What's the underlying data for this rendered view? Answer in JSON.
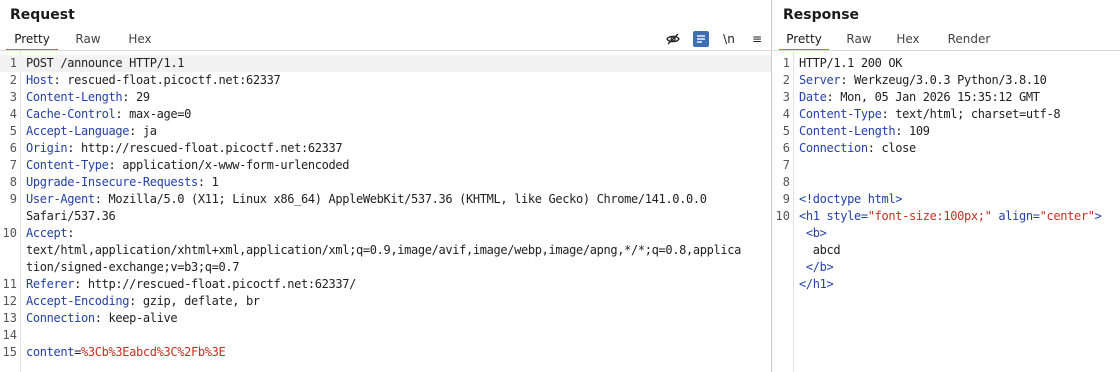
{
  "request": {
    "title": "Request",
    "tabs": [
      "Pretty",
      "Raw",
      "Hex"
    ],
    "active_tab": 0,
    "toolbar": {
      "icons": [
        "eye-slash-icon",
        "wrap-lines-icon",
        "newline-toggle",
        "menu-icon"
      ],
      "newline_label": "\\n",
      "menu_label": "≡"
    },
    "lines": [
      {
        "n": "1",
        "text": "POST /announce HTTP/1.1"
      },
      {
        "n": "2",
        "name": "Host",
        "value": "rescued-float.picoctf.net:62337"
      },
      {
        "n": "3",
        "name": "Content-Length",
        "value": "29"
      },
      {
        "n": "4",
        "name": "Cache-Control",
        "value": "max-age=0"
      },
      {
        "n": "5",
        "name": "Accept-Language",
        "value": "ja"
      },
      {
        "n": "6",
        "name": "Origin",
        "value": "http://rescued-float.picoctf.net:62337"
      },
      {
        "n": "7",
        "name": "Content-Type",
        "value": "application/x-www-form-urlencoded"
      },
      {
        "n": "8",
        "name": "Upgrade-Insecure-Requests",
        "value": "1"
      },
      {
        "n": "9",
        "name": "User-Agent",
        "value": "Mozilla/5.0 (X11; Linux x86_64) AppleWebKit/537.36 (KHTML, like Gecko) Chrome/141.0.0.0"
      },
      {
        "n": "",
        "text": "Safari/537.36"
      },
      {
        "n": "10",
        "name": "Accept",
        "value": ""
      },
      {
        "n": "",
        "text": "text/html,application/xhtml+xml,application/xml;q=0.9,image/avif,image/webp,image/apng,*/*;q=0.8,applica"
      },
      {
        "n": "",
        "text": "tion/signed-exchange;v=b3;q=0.7"
      },
      {
        "n": "11",
        "name": "Referer",
        "value": "http://rescued-float.picoctf.net:62337/"
      },
      {
        "n": "12",
        "name": "Accept-Encoding",
        "value": "gzip, deflate, br"
      },
      {
        "n": "13",
        "name": "Connection",
        "value": "keep-alive"
      },
      {
        "n": "14",
        "text": ""
      },
      {
        "n": "15",
        "param": "content",
        "param_value": "%3Cb%3Eabcd%3C%2Fb%3E"
      }
    ]
  },
  "response": {
    "title": "Response",
    "tabs": [
      "Pretty",
      "Raw",
      "Hex",
      "Render"
    ],
    "active_tab": 0,
    "lines": [
      {
        "n": "1",
        "text": "HTTP/1.1 200 OK"
      },
      {
        "n": "2",
        "name": "Server",
        "value": "Werkzeug/3.0.3 Python/3.8.10"
      },
      {
        "n": "3",
        "name": "Date",
        "value": "Mon, 05 Jan 2026 15:35:12 GMT"
      },
      {
        "n": "4",
        "name": "Content-Type",
        "value": "text/html; charset=utf-8"
      },
      {
        "n": "5",
        "name": "Content-Length",
        "value": "109"
      },
      {
        "n": "6",
        "name": "Connection",
        "value": "close"
      },
      {
        "n": "7",
        "text": ""
      },
      {
        "n": "8",
        "text": ""
      },
      {
        "n": "9",
        "html": [
          {
            "c": "tag",
            "t": "<!doctype html>"
          }
        ]
      },
      {
        "n": "10",
        "html": [
          {
            "c": "tag",
            "t": "<h1 "
          },
          {
            "c": "attr",
            "t": "style="
          },
          {
            "c": "aval",
            "t": "\"font-size:100px;\""
          },
          {
            "c": "attr",
            "t": " align="
          },
          {
            "c": "aval",
            "t": "\"center\""
          },
          {
            "c": "tag",
            "t": ">"
          }
        ]
      },
      {
        "n": "",
        "html": [
          {
            "c": "plain",
            "t": " "
          },
          {
            "c": "tag",
            "t": "<b>"
          }
        ]
      },
      {
        "n": "",
        "html": [
          {
            "c": "plain",
            "t": "  abcd"
          }
        ]
      },
      {
        "n": "",
        "html": [
          {
            "c": "plain",
            "t": " "
          },
          {
            "c": "tag",
            "t": "</b>"
          }
        ]
      },
      {
        "n": "",
        "html": [
          {
            "c": "tag",
            "t": "</h1>"
          }
        ]
      }
    ]
  },
  "colors": {
    "accent_tab": "#e8662a",
    "header_name": "#2442a6",
    "param_value": "#c2321f",
    "selected_icon_bg": "#3d6fb5"
  }
}
